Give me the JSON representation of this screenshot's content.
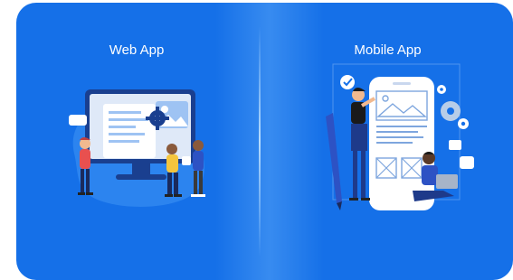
{
  "options": [
    {
      "label": "Web App"
    },
    {
      "label": "Mobile App"
    }
  ],
  "colors": {
    "card": "#1570e8",
    "screen_frame": "#dbe6f7",
    "accent_dark": "#0e3c8c",
    "figure_red": "#e8504f",
    "figure_yellow": "#f4c53d"
  }
}
